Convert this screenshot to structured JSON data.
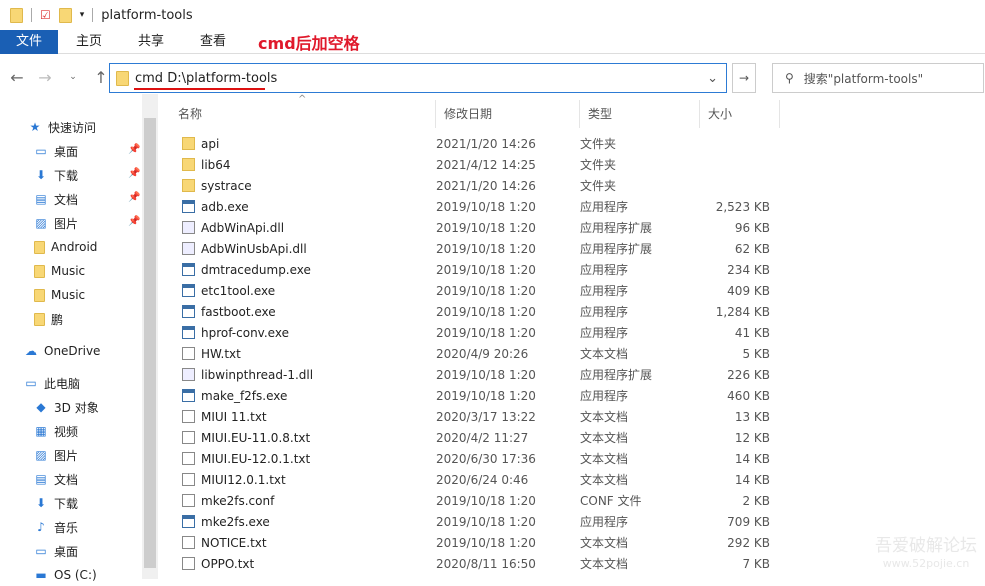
{
  "title": "platform-tools",
  "ribbon": {
    "tabs": [
      "文件",
      "主页",
      "共享",
      "查看"
    ],
    "annotation": "cmd后加空格"
  },
  "address": {
    "value": "cmd D:\\platform-tools"
  },
  "search": {
    "placeholder": "搜索\"platform-tools\""
  },
  "columns": [
    "名称",
    "修改日期",
    "类型",
    "大小"
  ],
  "sidebar": [
    {
      "label": "快速访问",
      "icon": "star-icon",
      "pin": false
    },
    {
      "label": "桌面",
      "icon": "desktop-icon",
      "pin": true
    },
    {
      "label": "下载",
      "icon": "download-icon",
      "pin": true
    },
    {
      "label": "文档",
      "icon": "document-icon",
      "pin": true
    },
    {
      "label": "图片",
      "icon": "picture-icon",
      "pin": true
    },
    {
      "label": "Android",
      "icon": "folder-icon",
      "pin": false
    },
    {
      "label": "Music",
      "icon": "folder-icon",
      "pin": false
    },
    {
      "label": "Music",
      "icon": "folder-icon",
      "pin": false
    },
    {
      "label": "鹏",
      "icon": "folder-icon",
      "pin": false
    },
    {
      "label": "OneDrive",
      "icon": "cloud-icon",
      "pin": false
    },
    {
      "label": "此电脑",
      "icon": "computer-icon",
      "pin": false
    },
    {
      "label": "3D 对象",
      "icon": "cube-icon",
      "pin": false
    },
    {
      "label": "视频",
      "icon": "video-icon",
      "pin": false
    },
    {
      "label": "图片",
      "icon": "picture-icon",
      "pin": false
    },
    {
      "label": "文档",
      "icon": "document-icon",
      "pin": false
    },
    {
      "label": "下载",
      "icon": "download-icon",
      "pin": false
    },
    {
      "label": "音乐",
      "icon": "music-icon",
      "pin": false
    },
    {
      "label": "桌面",
      "icon": "desktop-icon",
      "pin": false
    },
    {
      "label": "OS (C:)",
      "icon": "drive-icon",
      "pin": false
    }
  ],
  "files": [
    {
      "name": "api",
      "date": "2021/1/20 14:26",
      "type": "文件夹",
      "size": "",
      "kind": "folder"
    },
    {
      "name": "lib64",
      "date": "2021/4/12 14:25",
      "type": "文件夹",
      "size": "",
      "kind": "folder"
    },
    {
      "name": "systrace",
      "date": "2021/1/20 14:26",
      "type": "文件夹",
      "size": "",
      "kind": "folder"
    },
    {
      "name": "adb.exe",
      "date": "2019/10/18 1:20",
      "type": "应用程序",
      "size": "2,523 KB",
      "kind": "exe"
    },
    {
      "name": "AdbWinApi.dll",
      "date": "2019/10/18 1:20",
      "type": "应用程序扩展",
      "size": "96 KB",
      "kind": "dll"
    },
    {
      "name": "AdbWinUsbApi.dll",
      "date": "2019/10/18 1:20",
      "type": "应用程序扩展",
      "size": "62 KB",
      "kind": "dll"
    },
    {
      "name": "dmtracedump.exe",
      "date": "2019/10/18 1:20",
      "type": "应用程序",
      "size": "234 KB",
      "kind": "exe"
    },
    {
      "name": "etc1tool.exe",
      "date": "2019/10/18 1:20",
      "type": "应用程序",
      "size": "409 KB",
      "kind": "exe"
    },
    {
      "name": "fastboot.exe",
      "date": "2019/10/18 1:20",
      "type": "应用程序",
      "size": "1,284 KB",
      "kind": "exe"
    },
    {
      "name": "hprof-conv.exe",
      "date": "2019/10/18 1:20",
      "type": "应用程序",
      "size": "41 KB",
      "kind": "exe"
    },
    {
      "name": "HW.txt",
      "date": "2020/4/9 20:26",
      "type": "文本文档",
      "size": "5 KB",
      "kind": "txt"
    },
    {
      "name": "libwinpthread-1.dll",
      "date": "2019/10/18 1:20",
      "type": "应用程序扩展",
      "size": "226 KB",
      "kind": "dll"
    },
    {
      "name": "make_f2fs.exe",
      "date": "2019/10/18 1:20",
      "type": "应用程序",
      "size": "460 KB",
      "kind": "exe"
    },
    {
      "name": "MIUI 11.txt",
      "date": "2020/3/17 13:22",
      "type": "文本文档",
      "size": "13 KB",
      "kind": "txt"
    },
    {
      "name": "MIUI.EU-11.0.8.txt",
      "date": "2020/4/2 11:27",
      "type": "文本文档",
      "size": "12 KB",
      "kind": "txt"
    },
    {
      "name": "MIUI.EU-12.0.1.txt",
      "date": "2020/6/30 17:36",
      "type": "文本文档",
      "size": "14 KB",
      "kind": "txt"
    },
    {
      "name": "MIUI12.0.1.txt",
      "date": "2020/6/24 0:46",
      "type": "文本文档",
      "size": "14 KB",
      "kind": "txt"
    },
    {
      "name": "mke2fs.conf",
      "date": "2019/10/18 1:20",
      "type": "CONF 文件",
      "size": "2 KB",
      "kind": "txt"
    },
    {
      "name": "mke2fs.exe",
      "date": "2019/10/18 1:20",
      "type": "应用程序",
      "size": "709 KB",
      "kind": "exe"
    },
    {
      "name": "NOTICE.txt",
      "date": "2019/10/18 1:20",
      "type": "文本文档",
      "size": "292 KB",
      "kind": "txt"
    },
    {
      "name": "OPPO.txt",
      "date": "2020/8/11 16:50",
      "type": "文本文档",
      "size": "7 KB",
      "kind": "txt"
    }
  ],
  "watermark": {
    "line1": "吾爱破解论坛",
    "line2": "www.52pojie.cn"
  }
}
